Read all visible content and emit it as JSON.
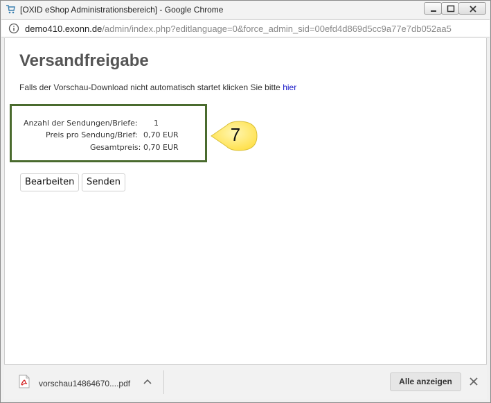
{
  "window": {
    "title": "[OXID eShop Administrationsbereich] - Google Chrome"
  },
  "addressbar": {
    "host": "demo410.exonn.de",
    "path": "/admin/index.php?editlanguage=0&force_admin_sid=00efd4d869d5cc9a77e7db052aa5"
  },
  "page": {
    "title": "Versandfreigabe",
    "notice_text": "Falls der Vorschau-Download nicht automatisch startet klicken Sie bitte ",
    "notice_link": "hier"
  },
  "summary": {
    "rows": [
      {
        "label": "Anzahl der Sendungen/Briefe:",
        "value": "1"
      },
      {
        "label": "Preis pro Sendung/Brief:",
        "value": "0,70 EUR"
      },
      {
        "label": "Gesamtpreis:",
        "value": "0,70 EUR"
      }
    ]
  },
  "callout": {
    "number": "7",
    "color": "#ffe766"
  },
  "buttons": {
    "edit_label": "Bearbeiten",
    "send_label": "Senden"
  },
  "downloads": {
    "file_name": "vorschau14864670....pdf",
    "show_all_label": "Alle anzeigen"
  },
  "icons": [
    "app-icon",
    "info-icon",
    "pdf-file-icon",
    "chevron-up-icon",
    "close-icon"
  ]
}
